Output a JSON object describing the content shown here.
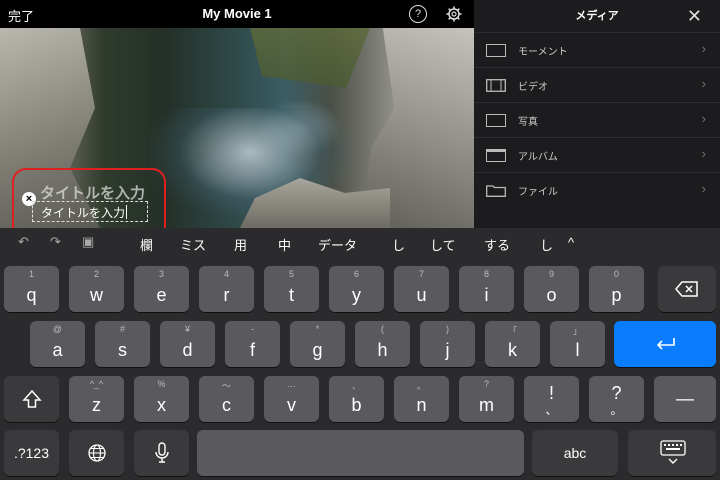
{
  "header": {
    "done_label": "完了",
    "project_title": "My Movie 1",
    "help_label": "?"
  },
  "preview": {
    "title_placeholder": "タイトルを入力",
    "title_input_value": "タイトルを入力",
    "clear_label": "×"
  },
  "media_panel": {
    "title": "メディア",
    "close_label": "✕",
    "items": [
      {
        "label": "モーメント"
      },
      {
        "label": "ビデオ"
      },
      {
        "label": "写真"
      },
      {
        "label": "アルバム"
      },
      {
        "label": "ファイル"
      }
    ]
  },
  "keyboard": {
    "candidates": [
      "欄",
      "ミス",
      "用",
      "中",
      "データ",
      "し",
      "して",
      "する",
      "し"
    ],
    "row1": [
      {
        "main": "q",
        "sub": "1"
      },
      {
        "main": "w",
        "sub": "2"
      },
      {
        "main": "e",
        "sub": "3"
      },
      {
        "main": "r",
        "sub": "4"
      },
      {
        "main": "t",
        "sub": "5"
      },
      {
        "main": "y",
        "sub": "6"
      },
      {
        "main": "u",
        "sub": "7"
      },
      {
        "main": "i",
        "sub": "8"
      },
      {
        "main": "o",
        "sub": "9"
      },
      {
        "main": "p",
        "sub": "0"
      }
    ],
    "row2": [
      {
        "main": "a",
        "sub": "@"
      },
      {
        "main": "s",
        "sub": "#"
      },
      {
        "main": "d",
        "sub": "¥"
      },
      {
        "main": "f",
        "sub": "-"
      },
      {
        "main": "g",
        "sub": "*"
      },
      {
        "main": "h",
        "sub": "("
      },
      {
        "main": "j",
        "sub": ")"
      },
      {
        "main": "k",
        "sub": "「"
      },
      {
        "main": "l",
        "sub": "」"
      }
    ],
    "row3": [
      {
        "main": "z",
        "sub": "^_^"
      },
      {
        "main": "x",
        "sub": "%"
      },
      {
        "main": "c",
        "sub": "〜"
      },
      {
        "main": "v",
        "sub": "…"
      },
      {
        "main": "b",
        "sub": "、"
      },
      {
        "main": "n",
        "sub": "。"
      },
      {
        "main": "m",
        "sub": "?"
      },
      {
        "main": "!",
        "sub": "、"
      },
      {
        "main": "?",
        "sub": "。"
      }
    ],
    "numbers_label": ".?123",
    "abc_label": "abc",
    "dash_label": "—"
  },
  "colors": {
    "accent_return": "#0a7cff",
    "highlight_box": "#e02020"
  }
}
